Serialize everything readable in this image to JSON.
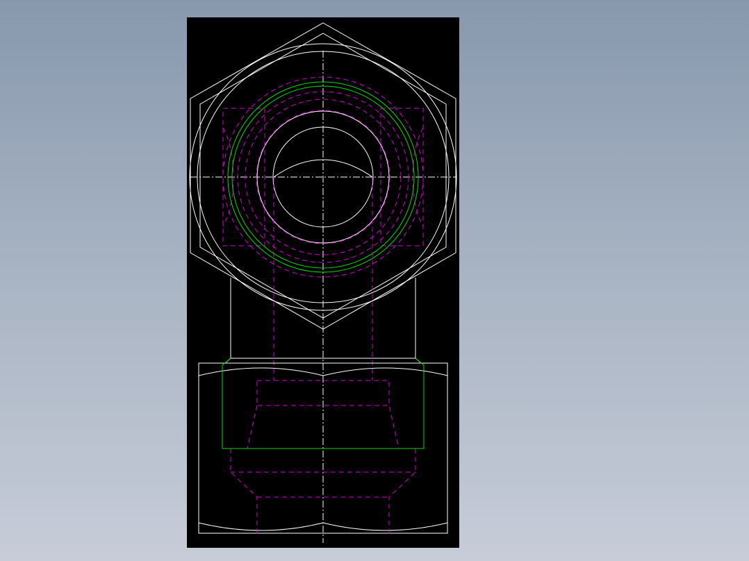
{
  "drawing": {
    "view": "cad-2d-fitting-drawing",
    "colors": {
      "background_top": "#8798ad",
      "background_bottom": "#c7ccd8",
      "sheet": "#000000",
      "outline": "#ffffff",
      "hidden": "#d400d4",
      "thread": "#00dd00"
    }
  }
}
